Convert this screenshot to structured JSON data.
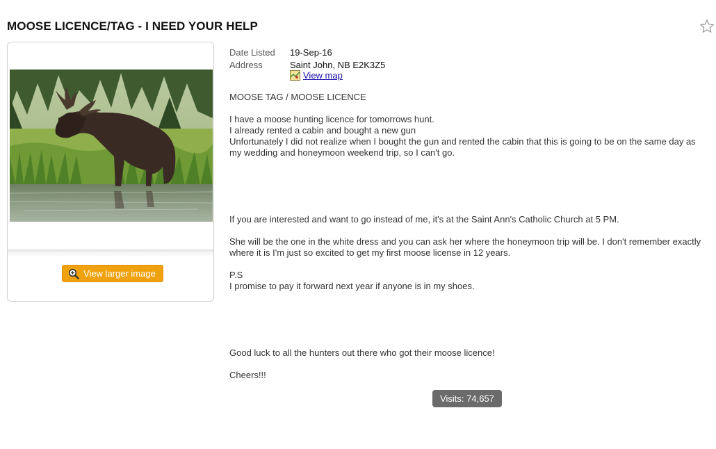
{
  "listing": {
    "title": "MOOSE LICENCE/TAG - I NEED YOUR HELP",
    "date_label": "Date Listed",
    "date_value": "19-Sep-16",
    "address_label": "Address",
    "address_value": "Saint John, NB E2K3Z5",
    "map_link": "View map",
    "favorite_icon": "star-outline-icon"
  },
  "image": {
    "alt": "moose standing in water",
    "view_larger_label": "View larger image",
    "view_larger_icon": "magnifier-plus-icon"
  },
  "description": {
    "p1": "MOOSE TAG / MOOSE LICENCE",
    "p2_line1": "I have a moose hunting licence for tomorrows hunt.",
    "p2_line2": "I already rented a cabin and bought a new gun",
    "p2_line3": "Unfortunately I did not realize when I bought the gun and rented the cabin that this is going to be on the same day as my wedding and honeymoon weekend trip, so I can't go.",
    "p3": "If you are interested and want to go instead of me, it's at the Saint Ann's Catholic Church at 5 PM.",
    "p4": "She will be the one in the white dress and you can ask her where the honeymoon trip will be. I don't remember exactly where it is I'm just so excited to get my first moose license in 12 years.",
    "p5_line1": "P.S",
    "p5_line2": "I promise to pay it forward next year if anyone is in my shoes.",
    "p6": "Good luck to all the hunters out there who got their moose licence!",
    "p7": "Cheers!!!"
  },
  "stats": {
    "visits": "Visits: 74,657"
  },
  "colors": {
    "button_orange": "#f0a20e",
    "badge_gray": "#6b6b6b",
    "link_blue": "#1a0dab"
  }
}
